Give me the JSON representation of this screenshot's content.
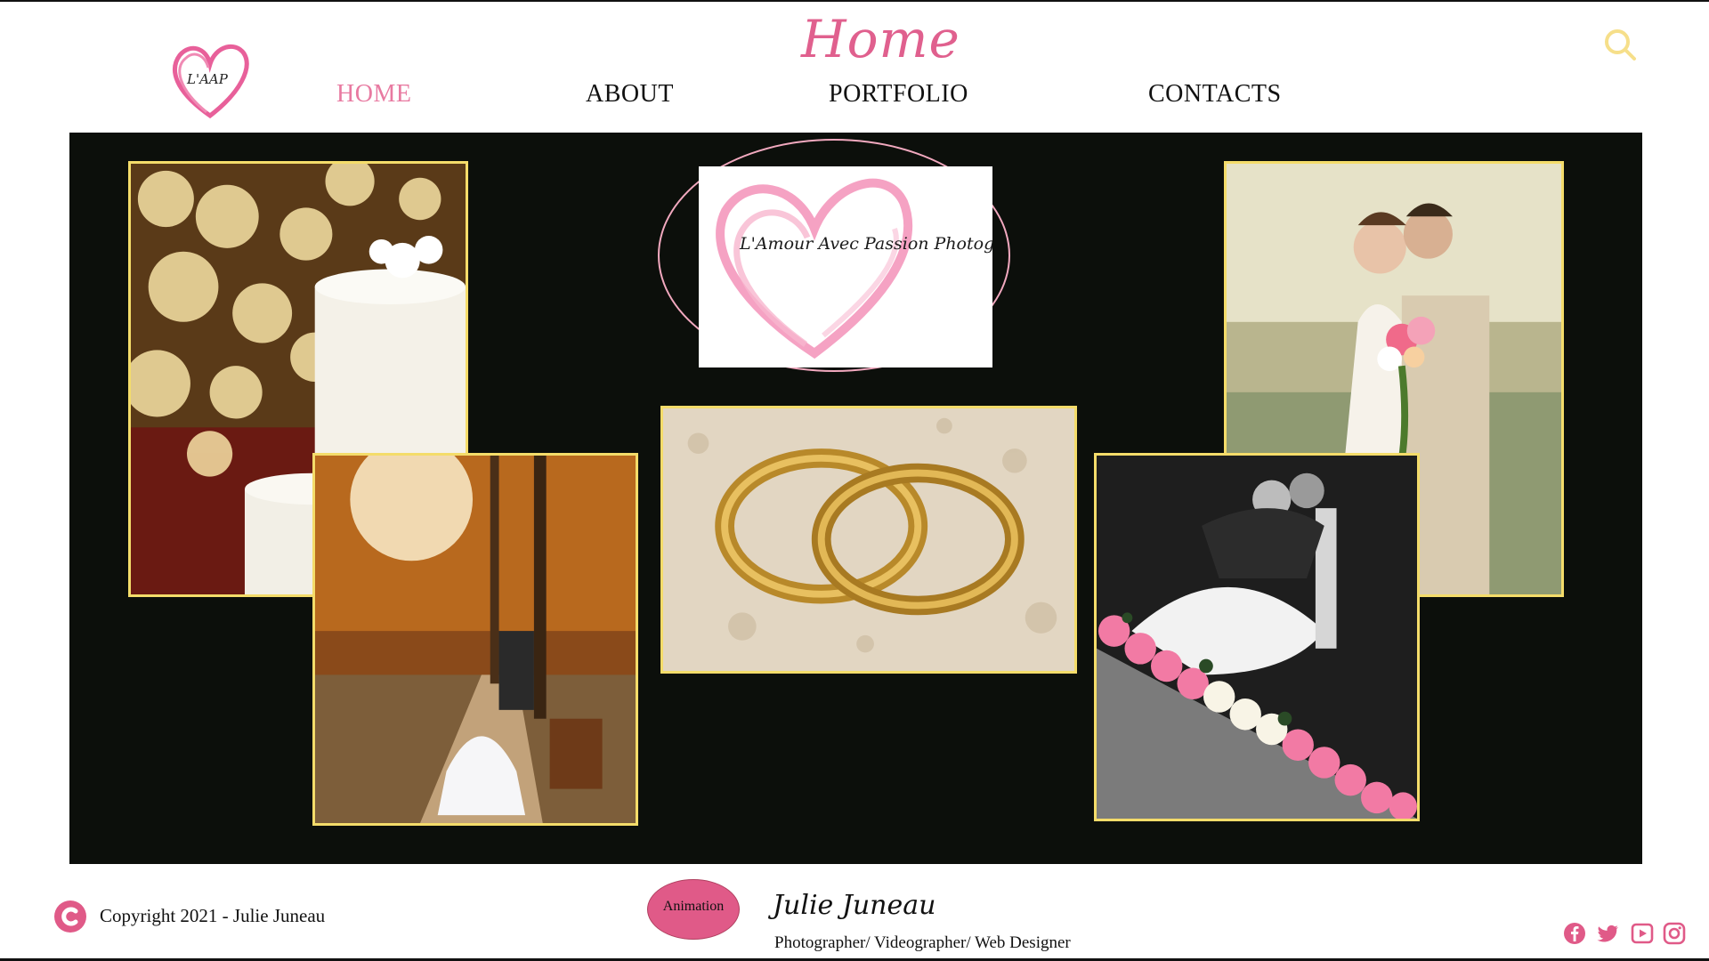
{
  "header": {
    "logo_text": "L'AAP",
    "page_title": "Home",
    "nav": [
      {
        "label": "HOME",
        "active": true
      },
      {
        "label": "ABOUT",
        "active": false
      },
      {
        "label": "PORTFOLIO",
        "active": false
      },
      {
        "label": "CONTACTS",
        "active": false
      }
    ],
    "search_icon": "search-icon"
  },
  "gallery": {
    "brand_text": "L'Amour Avec Passion Photography",
    "photos": [
      {
        "name": "photo-wedding-cake",
        "subject": "wedding cake with bokeh lights"
      },
      {
        "name": "photo-autumn-kiss",
        "subject": "couple kissing in autumn park"
      },
      {
        "name": "photo-wedding-rings",
        "subject": "two gold wedding rings"
      },
      {
        "name": "photo-couple-portrait",
        "subject": "bride and groom with bouquet"
      },
      {
        "name": "photo-black-white-dip",
        "subject": "black and white dip kiss with pink roses"
      }
    ]
  },
  "footer": {
    "copyright": "Copyright 2021 - Julie Juneau",
    "animation_button": "Animation",
    "signature": "Julie Juneau",
    "role": "Photographer/ Videographer/ Web Designer",
    "social": [
      "facebook-icon",
      "twitter-icon",
      "youtube-icon",
      "instagram-icon"
    ]
  },
  "colors": {
    "accent_pink": "#e87aa1",
    "frame_gold": "#f4dc6a",
    "stage_black": "#0c0f0b"
  }
}
